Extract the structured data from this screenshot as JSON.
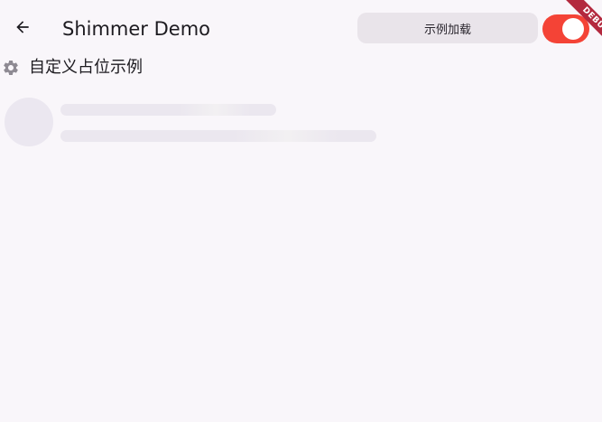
{
  "appbar": {
    "back_icon": "arrow-left-icon",
    "title": "Shimmer Demo",
    "load_button_label": "示例加载",
    "toggle": {
      "on": true,
      "color": "#f44336"
    }
  },
  "debug_banner": "DEBUG",
  "section": {
    "icon": "gear-icon",
    "label": "自定义占位示例"
  },
  "colors": {
    "background": "#f9f6fa",
    "placeholder": "#ebe7f0",
    "accent": "#f44336",
    "banner": "#b3293e"
  }
}
